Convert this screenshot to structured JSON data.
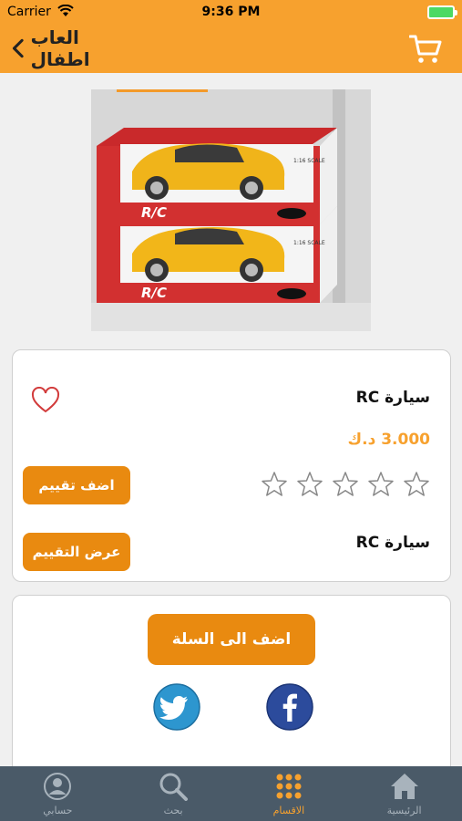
{
  "status": {
    "carrier": "Carrier",
    "time": "9:36 PM"
  },
  "nav": {
    "title": "العاب اطفال"
  },
  "product": {
    "name": "سيارة RC",
    "price": "3.000 د.ك",
    "rating": 0,
    "rating_max": 5,
    "rate_button": "اضف تقييم",
    "reviews_button": "عرض التقييم",
    "name_repeat": "سيارة RC",
    "box_brand": "R/C",
    "box_scale": "1:16 SCALE"
  },
  "actions": {
    "add_to_cart": "اضف الى السلة"
  },
  "colors": {
    "accent": "#f7a12e",
    "button": "#e98a10",
    "tabbar": "#4a5a68"
  },
  "tabs": [
    {
      "label": "حسابي",
      "icon": "profile-icon"
    },
    {
      "label": "بحث",
      "icon": "search-icon"
    },
    {
      "label": "الاقسام",
      "icon": "grid-icon",
      "active": true
    },
    {
      "label": "الرئيسية",
      "icon": "home-icon"
    }
  ]
}
